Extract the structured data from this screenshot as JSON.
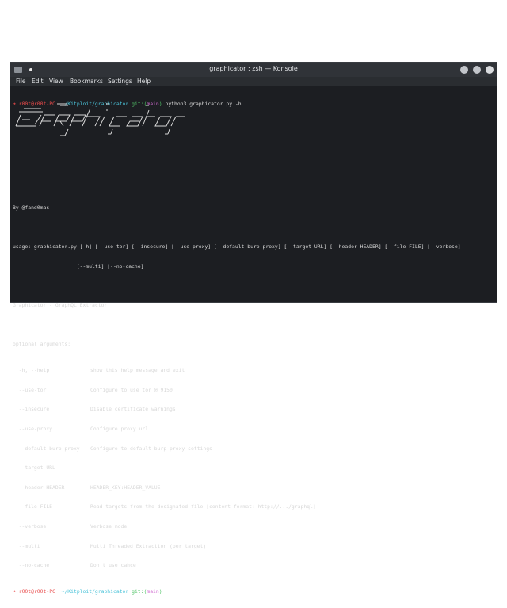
{
  "window": {
    "title": "graphicator : zsh — Konsole"
  },
  "menu": [
    "File",
    "Edit",
    "View",
    "Bookmarks",
    "Settings",
    "Help"
  ],
  "prompt": {
    "arrow": "➜",
    "user": "r00t@r00t-PC",
    "path": "~/Kitploit/graphicator",
    "git_label": "git:(",
    "branch": "main",
    "git_close": ")",
    "command": "python3 graphicator.py -h"
  },
  "output": {
    "author": "By @fand0mas",
    "usage_1": "usage: graphicator.py [-h] [--use-tor] [--insecure] [--use-proxy] [--default-burp-proxy] [--target URL] [--header HEADER] [--file FILE] [--verbose]",
    "usage_2": "                     [--multi] [--no-cache]",
    "description": "Graphicator - GraphQL Extractor",
    "optional_heading": "optional arguments:",
    "options": [
      {
        "flag": "  -h, --help",
        "desc": "show this help message and exit"
      },
      {
        "flag": "  --use-tor",
        "desc": "Configure to use tor @ 9150"
      },
      {
        "flag": "  --insecure",
        "desc": "Disable certificate warnings"
      },
      {
        "flag": "  --use-proxy",
        "desc": "Configure proxy url"
      },
      {
        "flag": "  --default-burp-proxy",
        "desc": "Configure to default burp proxy settings"
      },
      {
        "flag": "  --target URL",
        "desc": ""
      },
      {
        "flag": "  --header HEADER",
        "desc": "HEADER_KEY:HEADER_VALUE"
      },
      {
        "flag": "  --file FILE",
        "desc": "Read targets from the designated file [content format: http://.../graphql]"
      },
      {
        "flag": "  --verbose",
        "desc": "Verbose mode"
      },
      {
        "flag": "  --multi",
        "desc": "Multi Threaded Extraction (per target)"
      },
      {
        "flag": "  --no-cache",
        "desc": "Don't use cahce"
      }
    ]
  },
  "colors": {
    "prompt_user": "#e84a4a",
    "prompt_path": "#4bc3d9",
    "git": "#52c468",
    "branch": "#d06ad0"
  }
}
